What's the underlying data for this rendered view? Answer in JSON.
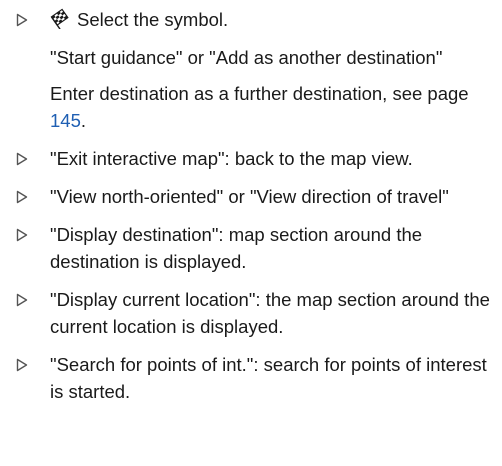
{
  "steps": [
    {
      "prefix": "",
      "text": "Select the symbol."
    },
    {
      "sub": "\"Start guidance\" or \"Add as another destination\""
    },
    {
      "sub_prefix": "Enter destination as a further destination, see page ",
      "link": "145",
      "sub_suffix": "."
    },
    {
      "text": "\"Exit interactive map\": back to the map view."
    },
    {
      "text": "\"View north-oriented\" or \"View direction of travel\""
    },
    {
      "text": "\"Display destination\": map section around the destination is displayed."
    },
    {
      "text": "\"Display current location\": the map section around the current location is displayed."
    },
    {
      "text": "\"Search for points of int.\": search for points of interest is started."
    }
  ],
  "icons": {
    "bullet": "triangle-right-outline-icon",
    "symbol": "checkered-flag-icon"
  },
  "colors": {
    "text": "#1a1a1a",
    "link": "#1f5fb3",
    "bullet": "#555555"
  }
}
